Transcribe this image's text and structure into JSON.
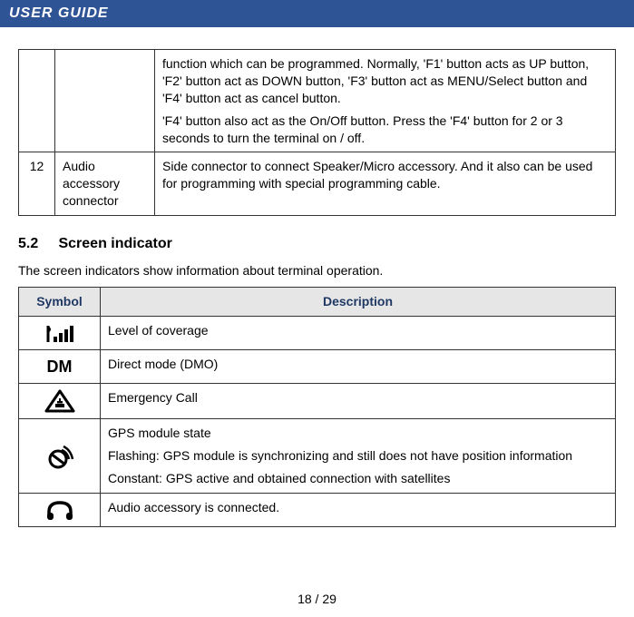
{
  "header": {
    "title": "USER GUIDE"
  },
  "table1": {
    "rows": [
      {
        "num": "",
        "name": "",
        "desc_p1": "function which can be programmed. Normally, 'F1' button acts as UP button, 'F2' button act as DOWN button, 'F3' button act as MENU/Select button and 'F4' button act as cancel button.",
        "desc_p2": "'F4' button also act as the On/Off button. Press the 'F4' button for 2 or 3 seconds to turn the terminal on / off."
      },
      {
        "num": "12",
        "name": "Audio accessory connector",
        "desc_p1": "Side connector to connect Speaker/Micro accessory. And it also can be used for programming with special programming cable.",
        "desc_p2": ""
      }
    ]
  },
  "section": {
    "number": "5.2",
    "title": "Screen indicator",
    "intro": "The screen indicators show information about terminal operation."
  },
  "table2": {
    "headers": {
      "symbol": "Symbol",
      "description": "Description"
    },
    "rows": [
      {
        "desc_p1": "Level of coverage",
        "desc_p2": "",
        "desc_p3": "",
        "icon": "signal"
      },
      {
        "desc_p1": "Direct mode (DMO)",
        "desc_p2": "",
        "desc_p3": "",
        "icon": "dm"
      },
      {
        "desc_p1": "Emergency Call",
        "desc_p2": "",
        "desc_p3": "",
        "icon": "emergency"
      },
      {
        "desc_p1": "GPS module state",
        "desc_p2": "Flashing: GPS module is synchronizing and still does not have position information",
        "desc_p3": "Constant: GPS active and obtained connection with satellites",
        "icon": "gps"
      },
      {
        "desc_p1": "Audio accessory is connected.",
        "desc_p2": "",
        "desc_p3": "",
        "icon": "headphone"
      }
    ]
  },
  "page": {
    "current": "18",
    "total": "29",
    "sep": " / "
  }
}
